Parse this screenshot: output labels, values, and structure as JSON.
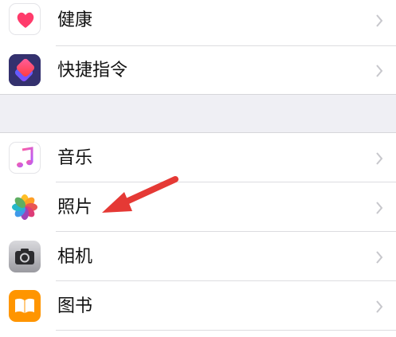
{
  "section1": {
    "items": [
      {
        "label": "健康",
        "icon": "health-heart-icon"
      },
      {
        "label": "快捷指令",
        "icon": "shortcuts-icon"
      }
    ]
  },
  "section2": {
    "items": [
      {
        "label": "音乐",
        "icon": "music-note-icon"
      },
      {
        "label": "照片",
        "icon": "photos-flower-icon"
      },
      {
        "label": "相机",
        "icon": "camera-icon"
      },
      {
        "label": "图书",
        "icon": "book-icon"
      }
    ]
  },
  "annotation": {
    "icon": "red-arrow-icon",
    "color": "#e53935"
  },
  "colors": {
    "background": "#efeff4",
    "separator": "#dcdce0",
    "chevron": "#c7c7cc"
  }
}
